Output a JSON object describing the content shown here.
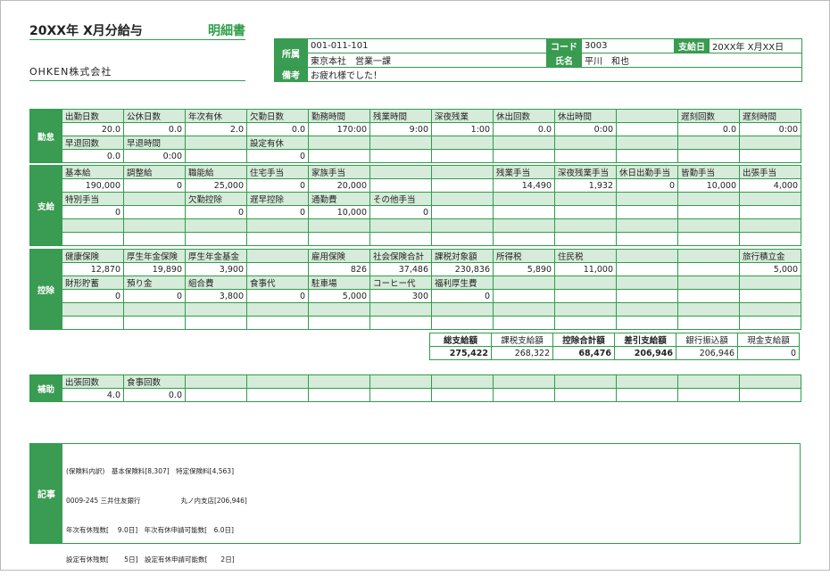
{
  "header": {
    "title": "20XX年 X月分給与",
    "meisai": "明細書",
    "company": "OHKEN株式会社"
  },
  "info": {
    "shozoku_label": "所属",
    "code_label": "コード",
    "pay_date_label": "支給日",
    "name_label": "氏名",
    "biko_label": "備考",
    "shozoku_code": "001-011-101",
    "shozoku_name": "東京本社　営業一課",
    "code": "3003",
    "pay_date": "20XX年 X月XX日",
    "name": "平川　和也",
    "biko": "お疲れ様でした！"
  },
  "kintai": {
    "section": "勤怠",
    "rows": [
      {
        "labels": [
          "出勤日数",
          "公休日数",
          "年次有休",
          "欠勤日数",
          "勤務時間",
          "残業時間",
          "深夜残業",
          "休出回数",
          "休出時間",
          "",
          "遅刻回数",
          "遅刻時間"
        ],
        "values": [
          "20.0",
          "0.0",
          "2.0",
          "0.0",
          "170:00",
          "9:00",
          "1:00",
          "0.0",
          "0:00",
          "",
          "0.0",
          "0:00"
        ]
      },
      {
        "labels": [
          "早退回数",
          "早退時間",
          "",
          "設定有休",
          "",
          "",
          "",
          "",
          "",
          "",
          "",
          ""
        ],
        "values": [
          "0.0",
          "0:00",
          "",
          "0",
          "",
          "",
          "",
          "",
          "",
          "",
          "",
          ""
        ]
      }
    ]
  },
  "shikyu": {
    "section": "支給",
    "rows": [
      {
        "labels": [
          "基本給",
          "調整給",
          "職能給",
          "住宅手当",
          "家族手当",
          "",
          "",
          "残業手当",
          "深夜残業手当",
          "休日出勤手当",
          "皆勤手当",
          "出張手当"
        ],
        "values": [
          "190,000",
          "0",
          "25,000",
          "0",
          "20,000",
          "",
          "",
          "14,490",
          "1,932",
          "0",
          "10,000",
          "4,000"
        ]
      },
      {
        "labels": [
          "特別手当",
          "",
          "欠勤控除",
          "遅早控除",
          "通勤費",
          "その他手当",
          "",
          "",
          "",
          "",
          "",
          ""
        ],
        "values": [
          "0",
          "",
          "0",
          "0",
          "10,000",
          "0",
          "",
          "",
          "",
          "",
          "",
          ""
        ]
      },
      {
        "labels": [
          "",
          "",
          "",
          "",
          "",
          "",
          "",
          "",
          "",
          "",
          "",
          ""
        ],
        "values": [
          "",
          "",
          "",
          "",
          "",
          "",
          "",
          "",
          "",
          "",
          "",
          ""
        ]
      }
    ]
  },
  "kojo": {
    "section": "控除",
    "rows": [
      {
        "labels": [
          "健康保険",
          "厚生年金保険",
          "厚生年金基金",
          "",
          "雇用保険",
          "社会保険合計",
          "課税対象額",
          "所得税",
          "住民税",
          "",
          "",
          "旅行積立金"
        ],
        "values": [
          "12,870",
          "19,890",
          "3,900",
          "",
          "826",
          "37,486",
          "230,836",
          "5,890",
          "11,000",
          "",
          "",
          "5,000"
        ]
      },
      {
        "labels": [
          "財形貯蓄",
          "預り金",
          "組合費",
          "食事代",
          "駐車場",
          "コーヒー代",
          "福利厚生費",
          "",
          "",
          "",
          "",
          ""
        ],
        "values": [
          "0",
          "0",
          "3,800",
          "0",
          "5,000",
          "300",
          "0",
          "",
          "",
          "",
          "",
          ""
        ]
      },
      {
        "labels": [
          "",
          "",
          "",
          "",
          "",
          "",
          "",
          "",
          "",
          "",
          "",
          ""
        ],
        "values": [
          "",
          "",
          "",
          "",
          "",
          "",
          "",
          "",
          "",
          "",
          "",
          ""
        ]
      }
    ]
  },
  "totals": {
    "labels": [
      "総支給額",
      "課税支給額",
      "控除合計額",
      "差引支給額",
      "銀行振込額",
      "現金支給額"
    ],
    "values": [
      "275,422",
      "268,322",
      "68,476",
      "206,946",
      "206,946",
      "0"
    ]
  },
  "hojo": {
    "section": "補助",
    "rows": [
      {
        "labels": [
          "出張回数",
          "食事回数",
          "",
          "",
          "",
          "",
          "",
          "",
          "",
          "",
          "",
          ""
        ],
        "values": [
          "4.0",
          "0.0",
          "",
          "",
          "",
          "",
          "",
          "",
          "",
          "",
          "",
          ""
        ]
      }
    ]
  },
  "kiji": {
    "section": "記事",
    "lines": [
      "(保険料内訳)　基本保険料[8,307]　特定保険料[4,563]",
      "0009-245 三井住友銀行　　　　　　丸ノ内支店[206,946]",
      "年次有休残数[　 9.0日]　年次有休申請可能数[　6.0日]",
      "設定有休残数[　　 5日]　設定有休申請可能数[　　2日]"
    ]
  }
}
